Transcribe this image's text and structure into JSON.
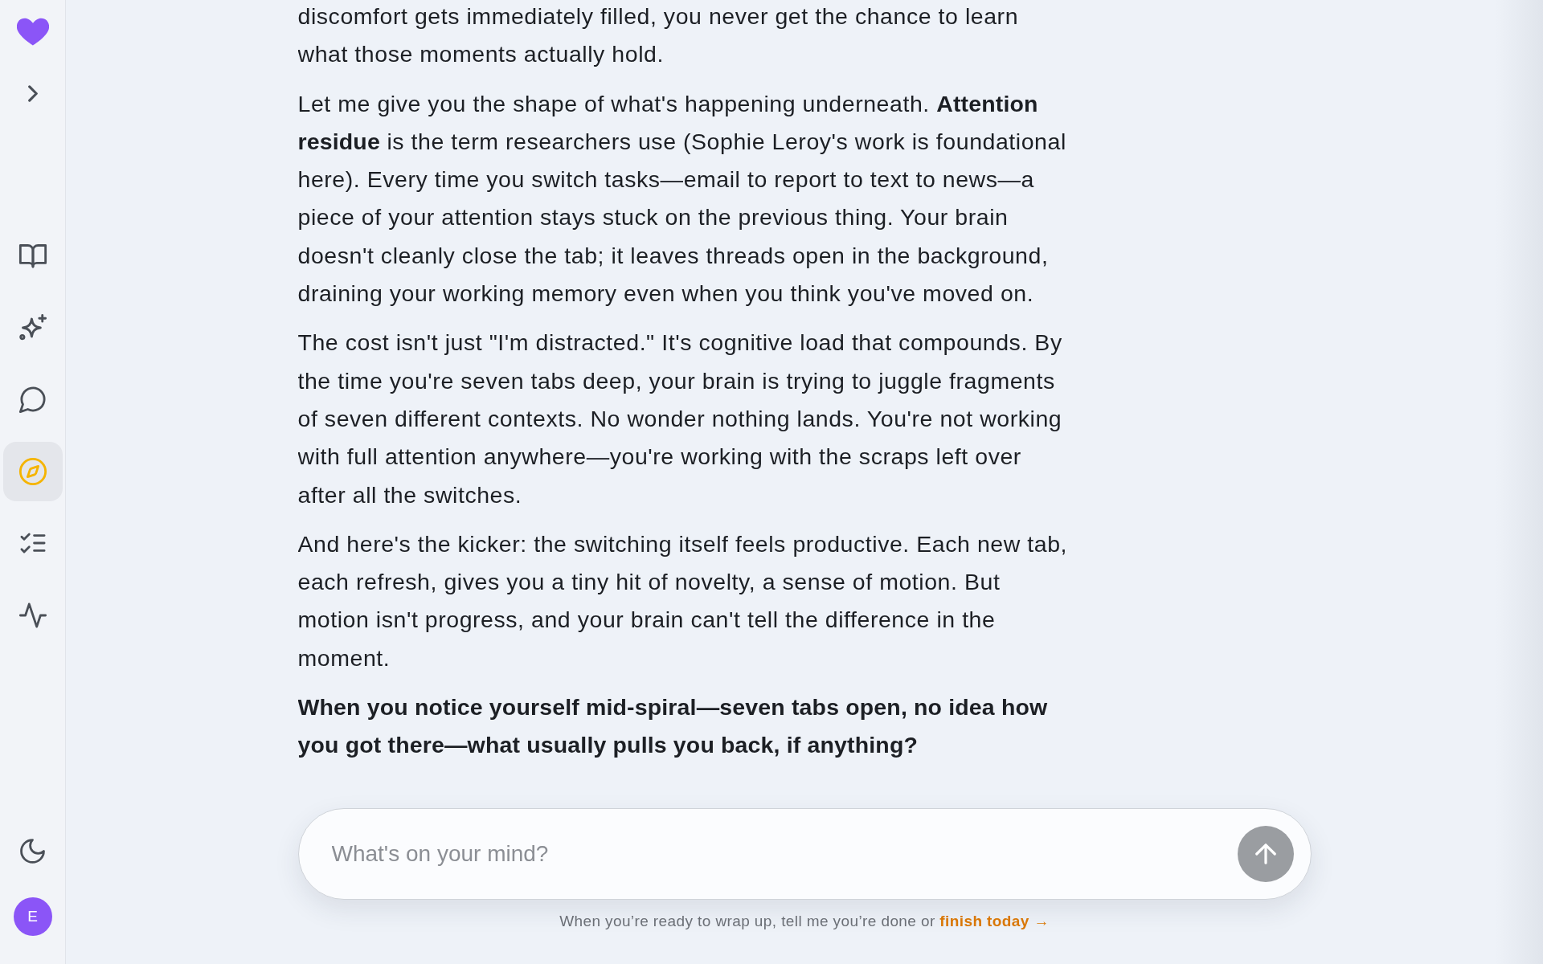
{
  "sidebar": {
    "nav_items": [
      {
        "selected": false
      },
      {
        "selected": false
      },
      {
        "selected": false
      },
      {
        "selected": true
      },
      {
        "selected": false
      },
      {
        "selected": false
      }
    ],
    "avatar": {
      "initial": "E"
    }
  },
  "conversation": {
    "paragraphs": [
      {
        "kind": "text",
        "text": "discomfort gets immediately filled, you never get the chance to learn what those moments actually hold."
      },
      {
        "kind": "text",
        "text": "Let me give you the shape of what's happening underneath. **Attention residue** is the term researchers use (Sophie Leroy's work is foundational here). Every time you switch tasks—email to report to text to news—a piece of your attention stays stuck on the previous thing. Your brain doesn't cleanly close the tab; it leaves threads open in the background, draining your working memory even when you think you've moved on."
      },
      {
        "kind": "text",
        "text": "The cost isn't just \"I'm distracted.\" It's cognitive load that compounds. By the time you're seven tabs deep, your brain is trying to juggle fragments of seven different contexts. No wonder nothing lands. You're not working with full attention anywhere—you're working with the scraps left over after all the switches."
      },
      {
        "kind": "text",
        "text": "And here's the kicker: the switching itself feels productive. Each new tab, each refresh, gives you a tiny hit of novelty, a sense of motion. But motion isn't progress, and your brain can't tell the difference in the moment."
      },
      {
        "kind": "question",
        "text": "When you notice yourself mid-spiral—seven tabs open, no idea how you got there—what usually pulls you back, if anything?"
      }
    ]
  },
  "composer": {
    "placeholder": "What's on your mind?",
    "send_button": {
      "disabled": true
    }
  },
  "footer": {
    "text": "When you’re ready to wrap up, tell me you’re done or",
    "link": "finish today →"
  }
}
